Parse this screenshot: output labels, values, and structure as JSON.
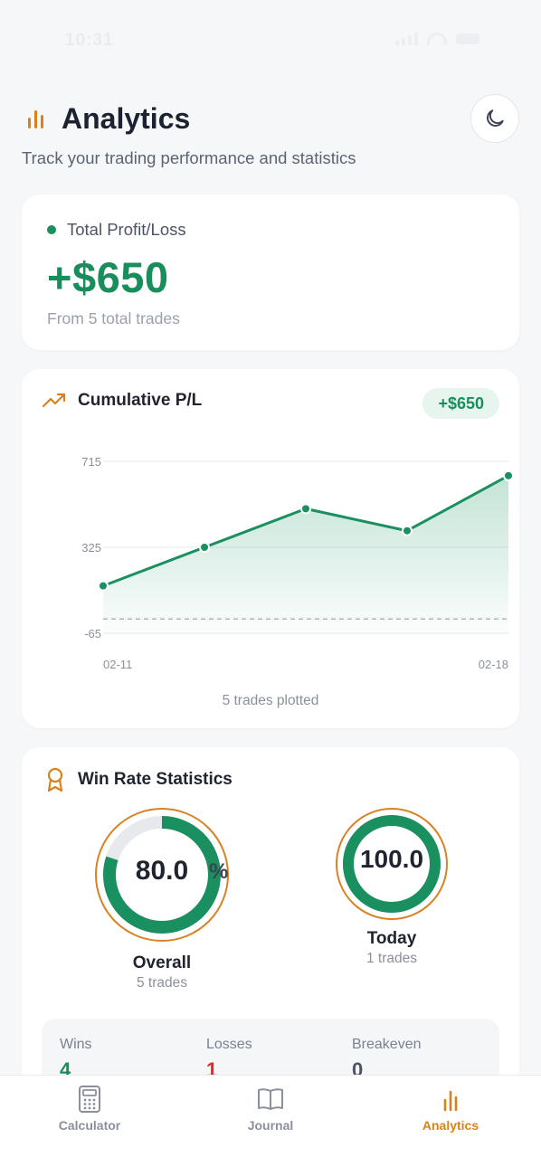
{
  "status_bar": {
    "time": "10:31"
  },
  "header": {
    "title": "Analytics",
    "subtitle": "Track your trading performance and statistics"
  },
  "total_pl": {
    "label": "Total Profit/Loss",
    "value": "+$650",
    "subtext": "From 5 total trades"
  },
  "cumulative": {
    "title": "Cumulative P/L",
    "badge": "+$650",
    "footer": "5 trades plotted",
    "y_ticks": [
      "715",
      "325",
      "-65"
    ],
    "x_ticks": [
      "02-11",
      "02-18"
    ]
  },
  "chart_data": {
    "type": "area",
    "x": [
      1,
      2,
      3,
      4,
      5
    ],
    "values": [
      150,
      325,
      500,
      400,
      650
    ],
    "ylim": [
      -65,
      715
    ],
    "xlabel": "",
    "ylabel": "",
    "grid": true,
    "baseline": 0
  },
  "win_rate": {
    "title": "Win Rate Statistics",
    "overall": {
      "value": "80.0",
      "percent": "%",
      "label": "Overall",
      "sub": "5 trades",
      "rate": 0.8
    },
    "today": {
      "value": "100.0",
      "label": "Today",
      "sub": "1 trades",
      "rate": 1.0
    },
    "stats": [
      {
        "label": "Wins",
        "value": "4",
        "color": "#198d5c"
      },
      {
        "label": "Losses",
        "value": "1",
        "color": "#d32f2f"
      },
      {
        "label": "Breakeven",
        "value": "0",
        "color": "#4c5363"
      }
    ]
  },
  "tabs": [
    {
      "label": "Calculator",
      "icon": "calculator-icon",
      "active": false
    },
    {
      "label": "Journal",
      "icon": "book-icon",
      "active": false
    },
    {
      "label": "Analytics",
      "icon": "bar-chart-icon",
      "active": true
    }
  ],
  "colors": {
    "accent": "#d9821a",
    "profit": "#198d5c",
    "loss": "#d32f2f"
  }
}
